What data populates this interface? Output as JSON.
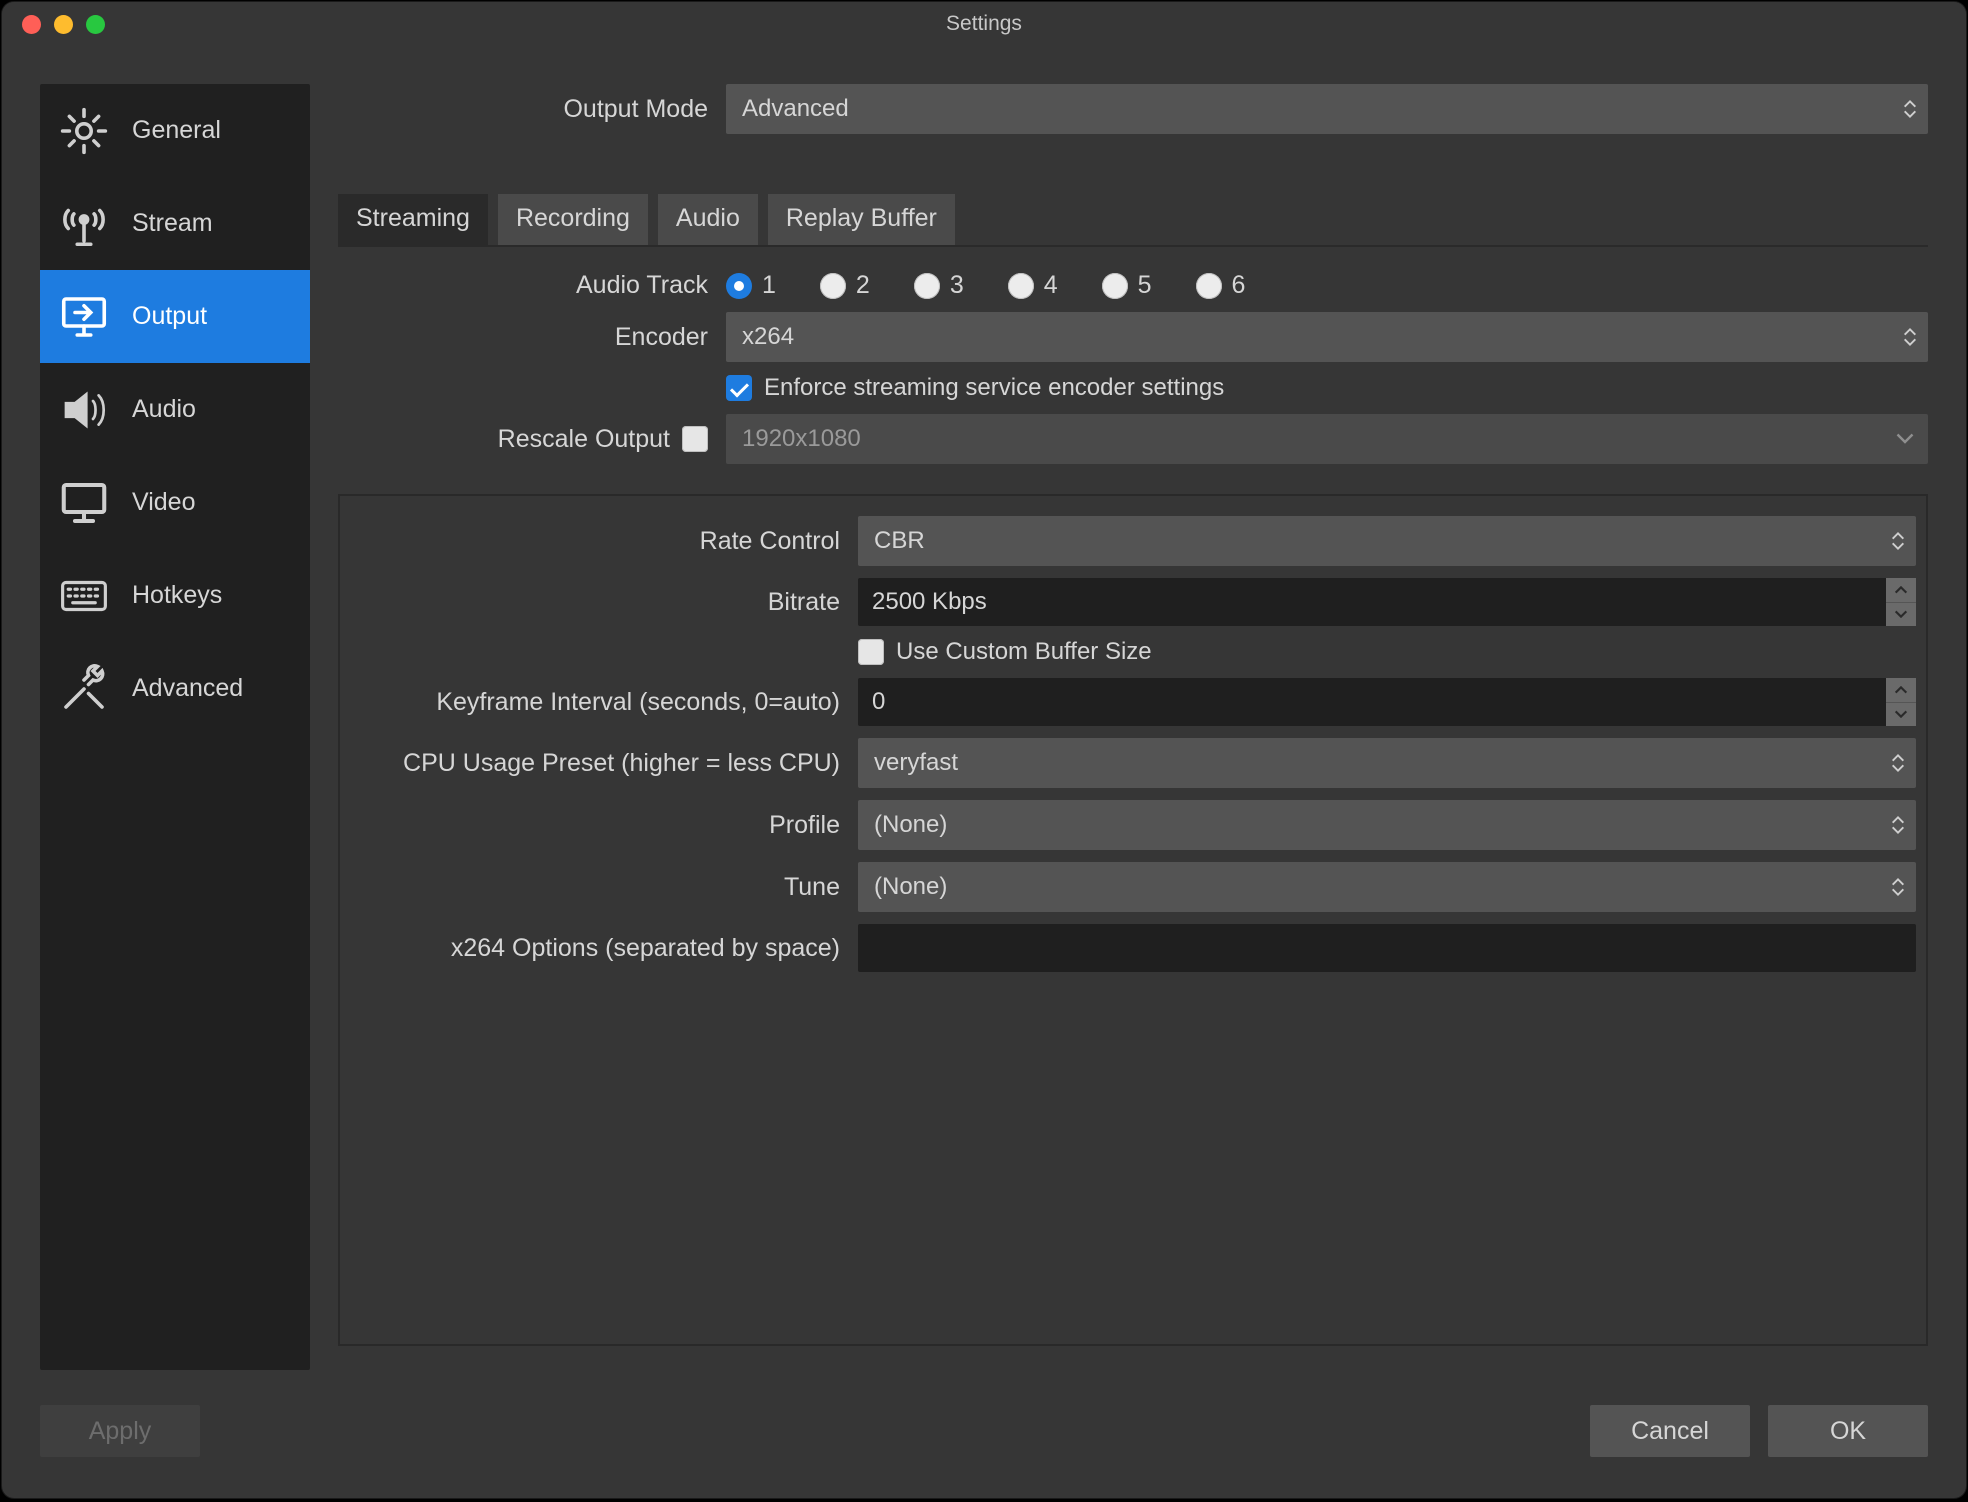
{
  "window": {
    "title": "Settings"
  },
  "sidebar": {
    "items": [
      {
        "label": "General"
      },
      {
        "label": "Stream"
      },
      {
        "label": "Output"
      },
      {
        "label": "Audio"
      },
      {
        "label": "Video"
      },
      {
        "label": "Hotkeys"
      },
      {
        "label": "Advanced"
      }
    ],
    "active": 2
  },
  "topform": {
    "output_mode_label": "Output Mode",
    "output_mode_value": "Advanced"
  },
  "tabs": {
    "items": [
      {
        "label": "Streaming"
      },
      {
        "label": "Recording"
      },
      {
        "label": "Audio"
      },
      {
        "label": "Replay Buffer"
      }
    ],
    "active": 0
  },
  "streaming": {
    "audio_track_label": "Audio Track",
    "audio_tracks": [
      "1",
      "2",
      "3",
      "4",
      "5",
      "6"
    ],
    "audio_track_selected": 0,
    "encoder_label": "Encoder",
    "encoder_value": "x264",
    "enforce_label": "Enforce streaming service encoder settings",
    "enforce_checked": true,
    "rescale_label": "Rescale Output",
    "rescale_checked": false,
    "rescale_value": "1920x1080"
  },
  "encoder_panel": {
    "rate_control_label": "Rate Control",
    "rate_control_value": "CBR",
    "bitrate_label": "Bitrate",
    "bitrate_value": "2500 Kbps",
    "custom_buffer_label": "Use Custom Buffer Size",
    "custom_buffer_checked": false,
    "keyframe_label": "Keyframe Interval (seconds, 0=auto)",
    "keyframe_value": "0",
    "cpu_preset_label": "CPU Usage Preset (higher = less CPU)",
    "cpu_preset_value": "veryfast",
    "profile_label": "Profile",
    "profile_value": "(None)",
    "tune_label": "Tune",
    "tune_value": "(None)",
    "x264_opts_label": "x264 Options (separated by space)",
    "x264_opts_value": ""
  },
  "footer": {
    "apply": "Apply",
    "cancel": "Cancel",
    "ok": "OK"
  }
}
